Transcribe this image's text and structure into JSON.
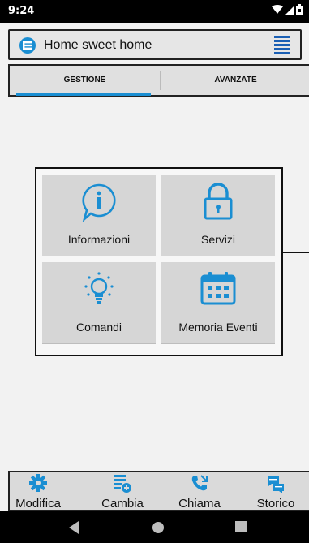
{
  "status_bar": {
    "time": "9:24"
  },
  "app_bar": {
    "title": "Home sweet home"
  },
  "tabs": [
    {
      "label": "GESTIONE",
      "active": true
    },
    {
      "label": "AVANZATE",
      "active": false
    }
  ],
  "tiles": [
    {
      "label": "Informazioni",
      "icon": "info-icon"
    },
    {
      "label": "Servizi",
      "icon": "lock-icon"
    },
    {
      "label": "Comandi",
      "icon": "lightbulb-icon"
    },
    {
      "label": "Memoria Eventi",
      "icon": "calendar-icon"
    }
  ],
  "bottom_nav": [
    {
      "label": "Modifica",
      "icon": "gear-icon"
    },
    {
      "label": "Cambia",
      "icon": "list-switch-icon"
    },
    {
      "label": "Chiama",
      "icon": "phone-icon"
    },
    {
      "label": "Storico",
      "icon": "sms-history-icon"
    }
  ],
  "colors": {
    "accent": "#1a8ed2",
    "tile_bg": "#d6d6d6",
    "frame": "#111111"
  }
}
